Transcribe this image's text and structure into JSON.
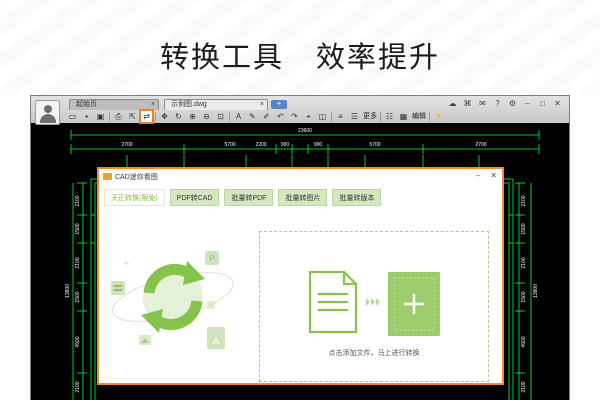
{
  "headline": {
    "left": "转换工具",
    "right": "效率提升"
  },
  "app": {
    "tabs": [
      {
        "label": "起始页"
      },
      {
        "label": "示例图.dwg"
      }
    ],
    "new_tab": "+",
    "toolbar": {
      "more_label": "更多",
      "edit_label": "编辑",
      "highlighted_tool": "convert-tool-icon"
    }
  },
  "drawing": {
    "top_dimensions": [
      "2700",
      "5700",
      "2200",
      "900",
      "900",
      "5700",
      "2700"
    ],
    "overall_dimension": "23600",
    "left_dimensions": [
      "2100",
      "1500",
      "2100",
      "1500",
      "4500",
      "2100"
    ],
    "left_overall": "13800",
    "right_dimensions": [
      "2100",
      "1500",
      "2100",
      "1500",
      "4500",
      "2100"
    ],
    "right_overall": "13800",
    "line_color": "#00ff33"
  },
  "dialog": {
    "title": "CAD迷你看图",
    "tabs": [
      {
        "label": "天正转换(限免)",
        "active": true
      },
      {
        "label": "PDF转CAD",
        "active": false
      },
      {
        "label": "批量转PDF",
        "active": false
      },
      {
        "label": "批量转图片",
        "active": false
      },
      {
        "label": "批量转版本",
        "active": false
      }
    ],
    "drop_hint": "点击添加文件，马上进行转换",
    "accent_color": "#86c34a"
  }
}
